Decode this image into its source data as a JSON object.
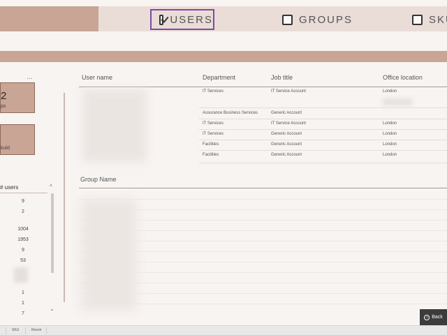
{
  "nav": {
    "tabs": [
      {
        "label": "USERS",
        "checked": true
      },
      {
        "label": "GROUPS",
        "checked": false
      },
      {
        "label": "SKU",
        "checked": false
      }
    ]
  },
  "sidebar": {
    "menu": "...",
    "kpi1": {
      "number": "2",
      "label": "ps"
    },
    "kpi2": {
      "number": "",
      "label": "kuld"
    },
    "users_header": "# users",
    "user_counts": [
      "9",
      "2",
      "1004",
      "1953",
      "9",
      "53",
      "1",
      "1",
      "7"
    ]
  },
  "users_table": {
    "headers": [
      "User name",
      "Department",
      "Job title",
      "Office location"
    ],
    "rows": [
      {
        "department": "IT Services",
        "job_title": "IT Service Account",
        "office": "London"
      },
      {
        "department": "Assurance Business Services",
        "job_title": "Generic Account",
        "office": ""
      },
      {
        "department": "IT Services",
        "job_title": "IT Service Account",
        "office": "London"
      },
      {
        "department": "IT Services",
        "job_title": "Generic Account",
        "office": "London"
      },
      {
        "department": "Facilities",
        "job_title": "Generic Account",
        "office": "London"
      },
      {
        "department": "Facilities",
        "job_title": "Generic Account",
        "office": "London"
      }
    ]
  },
  "groups_table": {
    "header": "Group Name"
  },
  "back_button": {
    "label": "Back"
  },
  "bottom_tabs": [
    "SKU",
    "Revoir"
  ],
  "colors": {
    "accent": "#c8a595",
    "selection": "#7a4aa8",
    "background": "#f8f4f2"
  }
}
